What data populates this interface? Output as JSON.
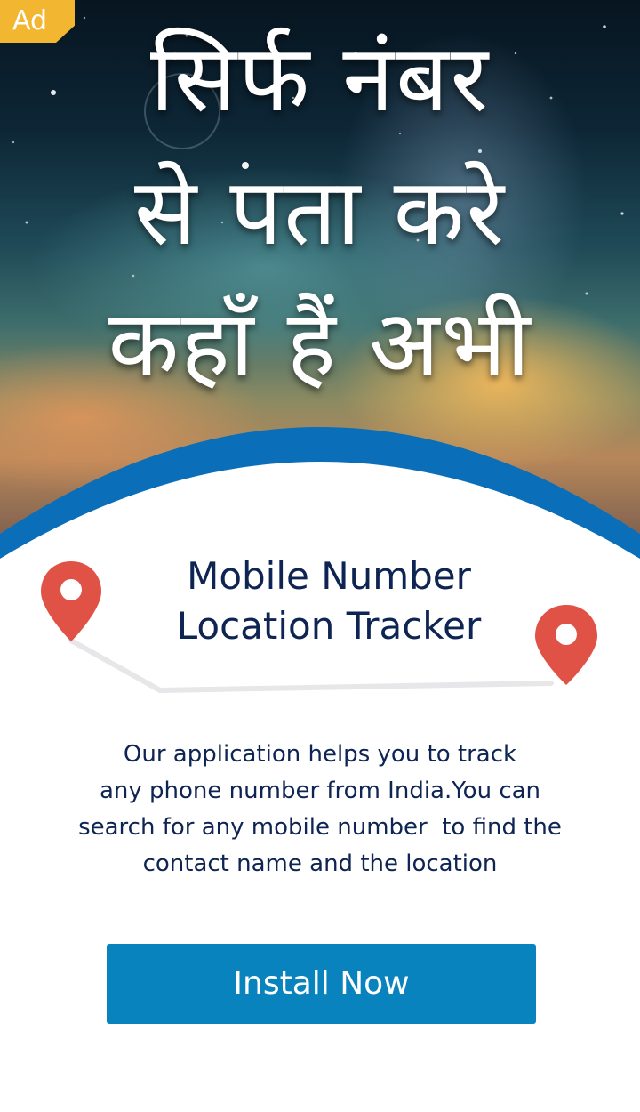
{
  "ad_badge": {
    "label": "Ad",
    "color": "#f2b630"
  },
  "hero": {
    "headline_lines": [
      "सिर्फ नंबर",
      "से पता करे",
      "कहाँ हैं अभी"
    ]
  },
  "app": {
    "title_lines": [
      "Mobile Number",
      "Location Tracker"
    ],
    "description_lines": [
      "Our application helps you to track",
      "any phone number from India.You can",
      "search for any mobile number  to find the",
      "contact name and the location"
    ]
  },
  "install_button": {
    "label": "Install Now",
    "color": "#0883bd"
  },
  "icons": {
    "left_pin": "map-pin-icon",
    "right_pin": "map-pin-icon"
  },
  "colors": {
    "title_text": "#0e2452",
    "pin": "#e05245",
    "arc_blue": "#0a6fb8"
  }
}
